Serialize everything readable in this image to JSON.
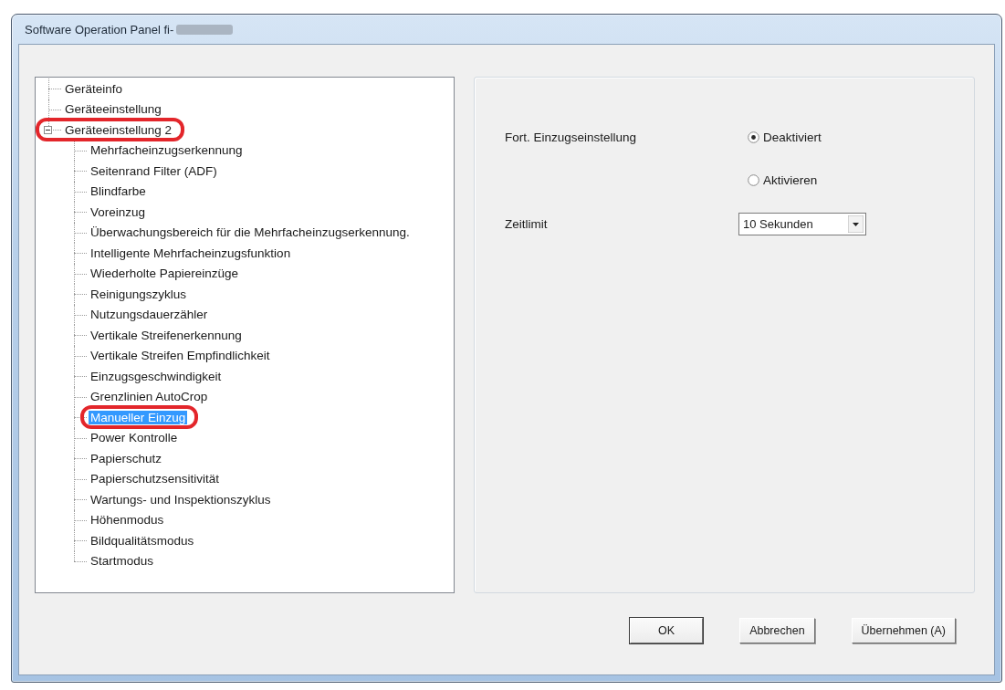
{
  "window": {
    "title": "Software Operation Panel fi-",
    "title_redacted": true
  },
  "tree": {
    "items": [
      {
        "label": "Geräteinfo",
        "selected": false,
        "highlighted": false
      },
      {
        "label": "Geräteeinstellung",
        "selected": false,
        "highlighted": false
      },
      {
        "label": "Geräteeinstellung 2",
        "selected": false,
        "highlighted": true,
        "expanded": true,
        "children": [
          {
            "label": "Mehrfacheinzugserkennung",
            "selected": false,
            "highlighted": false
          },
          {
            "label": "Seitenrand Filter (ADF)",
            "selected": false,
            "highlighted": false
          },
          {
            "label": "Blindfarbe",
            "selected": false,
            "highlighted": false
          },
          {
            "label": "Voreinzug",
            "selected": false,
            "highlighted": false
          },
          {
            "label": "Überwachungsbereich für die Mehrfacheinzugserkennung.",
            "selected": false,
            "highlighted": false
          },
          {
            "label": "Intelligente Mehrfacheinzugsfunktion",
            "selected": false,
            "highlighted": false
          },
          {
            "label": "Wiederholte Papiereinzüge",
            "selected": false,
            "highlighted": false
          },
          {
            "label": "Reinigungszyklus",
            "selected": false,
            "highlighted": false
          },
          {
            "label": "Nutzungsdauerzähler",
            "selected": false,
            "highlighted": false
          },
          {
            "label": "Vertikale Streifenerkennung",
            "selected": false,
            "highlighted": false
          },
          {
            "label": "Vertikale Streifen Empfindlichkeit",
            "selected": false,
            "highlighted": false
          },
          {
            "label": "Einzugsgeschwindigkeit",
            "selected": false,
            "highlighted": false
          },
          {
            "label": "Grenzlinien AutoCrop",
            "selected": false,
            "highlighted": false
          },
          {
            "label": "Manueller Einzug",
            "selected": true,
            "highlighted": true
          },
          {
            "label": "Power Kontrolle",
            "selected": false,
            "highlighted": false
          },
          {
            "label": "Papierschutz",
            "selected": false,
            "highlighted": false
          },
          {
            "label": "Papierschutzsensitivität",
            "selected": false,
            "highlighted": false
          },
          {
            "label": "Wartungs- und Inspektionszyklus",
            "selected": false,
            "highlighted": false
          },
          {
            "label": "Höhenmodus",
            "selected": false,
            "highlighted": false
          },
          {
            "label": "Bildqualitätsmodus",
            "selected": false,
            "highlighted": false
          },
          {
            "label": "Startmodus",
            "selected": false,
            "highlighted": false
          }
        ]
      }
    ]
  },
  "settings": {
    "rows": [
      {
        "kind": "radio",
        "label": "Fort. Einzugseinstellung",
        "options": [
          {
            "label": "Deaktiviert",
            "selected": true
          },
          {
            "label": "Aktivieren",
            "selected": false
          }
        ]
      },
      {
        "kind": "dropdown",
        "label": "Zeitlimit",
        "value": "10 Sekunden"
      }
    ]
  },
  "buttons": [
    {
      "label": "OK",
      "default": true
    },
    {
      "label": "Abbrechen",
      "default": false
    },
    {
      "label": "Übernehmen (A)",
      "default": false
    }
  ]
}
